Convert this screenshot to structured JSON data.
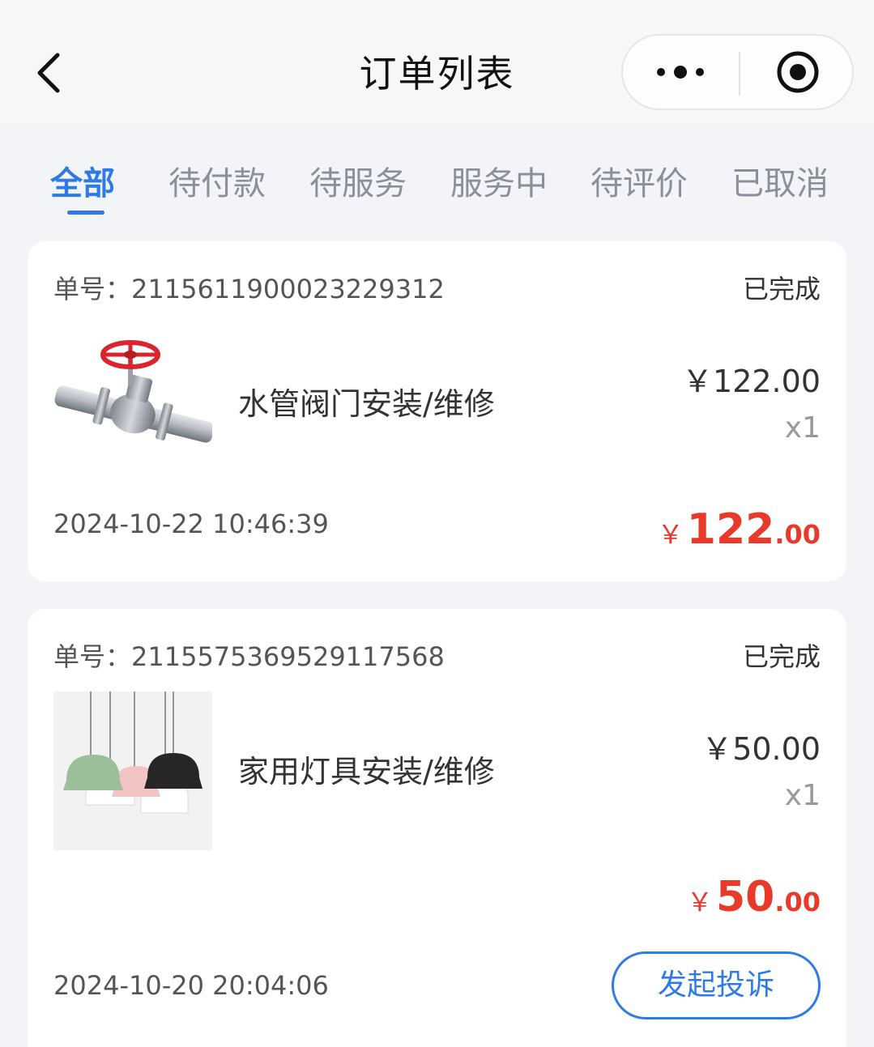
{
  "header": {
    "title": "订单列表"
  },
  "tabs": [
    {
      "label": "全部",
      "active": true
    },
    {
      "label": "待付款",
      "active": false
    },
    {
      "label": "待服务",
      "active": false
    },
    {
      "label": "服务中",
      "active": false
    },
    {
      "label": "待评价",
      "active": false
    },
    {
      "label": "已取消",
      "active": false
    }
  ],
  "orders": [
    {
      "order_no": "单号：2115611900023229312",
      "status": "已完成",
      "product_name": "水管阀门安装/维修",
      "image": "valve-image",
      "unit_price": "￥122.00",
      "quantity": "x1",
      "time": "2024-10-22 10:46:39",
      "total_currency": "￥",
      "total_int": "122",
      "total_dec": ".00"
    },
    {
      "order_no": "单号：2115575369529117568",
      "status": "已完成",
      "product_name": "家用灯具安装/维修",
      "image": "pendant-lamps-image",
      "unit_price": "￥50.00",
      "quantity": "x1",
      "time": "2024-10-20 20:04:06",
      "total_currency": "￥",
      "total_int": "50",
      "total_dec": ".00",
      "action_label": "发起投诉"
    }
  ],
  "colors": {
    "accent": "#2f7be6",
    "price_red": "#e8392b",
    "background": "#f3f4f8"
  }
}
